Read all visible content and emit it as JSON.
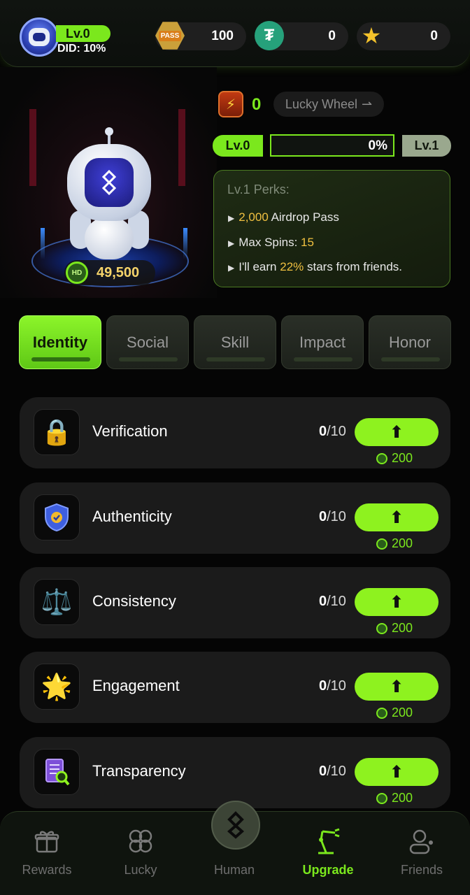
{
  "header": {
    "level_label": "Lv.0",
    "did_label": "DID: 10%",
    "pass_count": "100",
    "usdt_count": "0",
    "star_count": "0",
    "pass_icon_text": "PASS"
  },
  "hero": {
    "coin_value": "49,500",
    "coin_icon_text": "HD"
  },
  "energy": {
    "count": "0",
    "lucky_wheel_label": "Lucky Wheel"
  },
  "level_bar": {
    "current": "Lv.0",
    "next": "Lv.1",
    "progress_text": "0%",
    "progress_fraction": 0
  },
  "perks": {
    "title": "Lv.1 Perks:",
    "lines": [
      {
        "pre": "",
        "hl": "2,000",
        "post": " Airdrop Pass"
      },
      {
        "pre": "Max Spins: ",
        "hl": "15",
        "post": ""
      },
      {
        "pre": "I'll earn ",
        "hl": "22%",
        "post": " stars from friends."
      }
    ]
  },
  "tabs": [
    {
      "label": "Identity",
      "active": true
    },
    {
      "label": "Social",
      "active": false
    },
    {
      "label": "Skill",
      "active": false
    },
    {
      "label": "Impact",
      "active": false
    },
    {
      "label": "Honor",
      "active": false
    }
  ],
  "skills": [
    {
      "name": "Verification",
      "level": "0",
      "max": "/10",
      "cost": "200",
      "icon": "lock-icon"
    },
    {
      "name": "Authenticity",
      "level": "0",
      "max": "/10",
      "cost": "200",
      "icon": "shield-check-icon"
    },
    {
      "name": "Consistency",
      "level": "0",
      "max": "/10",
      "cost": "200",
      "icon": "scales-icon"
    },
    {
      "name": "Engagement",
      "level": "0",
      "max": "/10",
      "cost": "200",
      "icon": "rainbow-star-icon"
    },
    {
      "name": "Transparency",
      "level": "0",
      "max": "/10",
      "cost": "200",
      "icon": "document-search-icon"
    }
  ],
  "nav": [
    {
      "label": "Rewards",
      "icon": "gift-icon",
      "active": false
    },
    {
      "label": "Lucky",
      "icon": "clover-icon",
      "active": false
    },
    {
      "label": "Human",
      "icon": "human-logo-icon",
      "active": false
    },
    {
      "label": "Upgrade",
      "icon": "robot-arm-icon",
      "active": true
    },
    {
      "label": "Friends",
      "icon": "friends-icon",
      "active": false
    }
  ],
  "colors": {
    "accent": "#7be81d",
    "highlight": "#f0c040",
    "card_bg": "#1b1b1b"
  }
}
